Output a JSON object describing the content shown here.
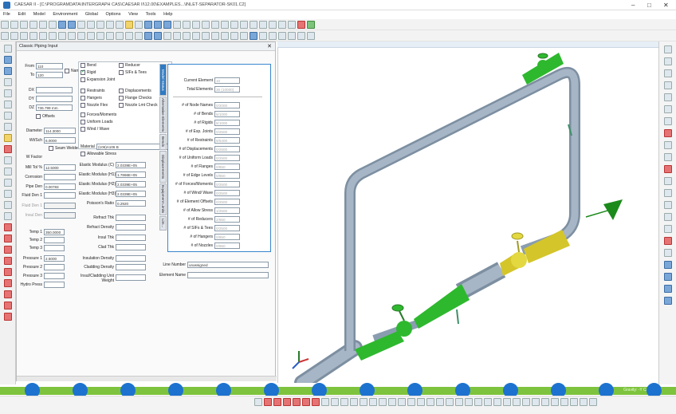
{
  "title": "CAESAR II - [C:\\PROGRAMDATA\\INTERGRAPH CAS\\CAESAR II\\12.00\\EXAMPLES...\\INLET-SEPARATOR-SK01.C2]",
  "window_controls": {
    "minimize": "–",
    "maximize": "□",
    "close": "✕"
  },
  "menu": [
    "File",
    "Edit",
    "Model",
    "Environment",
    "Global",
    "Options",
    "View",
    "Tools",
    "Help"
  ],
  "panel": {
    "title": "Classic Piping Input",
    "from_label": "From",
    "from_value": "110",
    "to_label": "To",
    "to_value": "120",
    "name_label": "Name",
    "dx_label": "DX",
    "dy_label": "DY",
    "dz_label": "DZ",
    "dz_value": "736.799 mm",
    "offsets_label": "Offsets",
    "diameter_label": "Diameter",
    "diameter_value": "114.3000",
    "wt_label": "Wt/Sch",
    "wt_value": "6.0000",
    "seam_label": "Seam Welded",
    "wifactor_label": "W Factor",
    "milltol_label": "Mill Tol %",
    "milltol_value": "12.5000",
    "corrosion_label": "Corrosion",
    "pipeden_label": "Pipe Den",
    "pipeden_value": "0.00783",
    "fluidden_label": "Fluid Den 1",
    "fluiddensg_label": "Fluid Den 1",
    "insul_label": "Insul Den",
    "temps": [
      {
        "label": "Temp 1",
        "value": "350.0000"
      },
      {
        "label": "Temp 2",
        "value": ""
      },
      {
        "label": "Temp 3",
        "value": ""
      }
    ],
    "pressures": [
      {
        "label": "Pressure 1",
        "value": "2.5000"
      },
      {
        "label": "Pressure 2",
        "value": ""
      },
      {
        "label": "Pressure 3",
        "value": ""
      }
    ],
    "hydro_label": "Hydro Press",
    "checks_col1": [
      {
        "label": "Bend",
        "on": false
      },
      {
        "label": "Rigid",
        "on": true
      },
      {
        "label": "Expansion Joint",
        "on": false
      }
    ],
    "checks_col2": [
      {
        "label": "Reducer",
        "on": false
      },
      {
        "label": "SIFs & Tees",
        "on": false
      }
    ],
    "checks_col3": [
      {
        "label": "Restraints",
        "on": false
      },
      {
        "label": "Hangers",
        "on": false
      },
      {
        "label": "Nozzle Flex",
        "on": false
      }
    ],
    "checks_col4": [
      {
        "label": "Displacements",
        "on": false
      },
      {
        "label": "Flange Checks",
        "on": false
      },
      {
        "label": "Nozzle Lmt Check",
        "on": false
      }
    ],
    "checks_col5": [
      {
        "label": "Forces/Moments",
        "on": false
      },
      {
        "label": "Uniform Loads",
        "on": false
      },
      {
        "label": "Wind / Wave",
        "on": false
      }
    ],
    "material_label": "Material",
    "material_value": "(106)A106 B",
    "allowable_label": "Allowable Stress",
    "elastic": [
      {
        "label": "Elastic Modulus (C)",
        "value": "2.0339E+05"
      },
      {
        "label": "Elastic Modulus (H1)",
        "value": "1.7866E+05"
      },
      {
        "label": "Elastic Modulus (H2)",
        "value": "2.0339E+05"
      },
      {
        "label": "Elastic Modulus (H3)",
        "value": "2.0339E+05"
      }
    ],
    "poisson_label": "Poisson's Ratio",
    "poisson_value": "0.2920",
    "refract_th_label": "Refract Thk",
    "refract_den_label": "Refract Density",
    "insul_th_label": "Insul Thk",
    "clad_th_label": "Clad Thk",
    "insul_den_label": "Insulation Density",
    "clad_den_label": "Cladding Density",
    "insul_clad_label": "Insul/Cladding Unit Weight",
    "line_label": "Line Number",
    "line_value": "unassigned",
    "element_label": "Element Name"
  },
  "sidetabs": [
    {
      "label": "Model Status",
      "active": true
    },
    {
      "label": "Alternative Elements",
      "active": false
    },
    {
      "label": "Bends",
      "active": false
    },
    {
      "label": "Displacements",
      "active": false
    },
    {
      "label": "Equipment Limits",
      "active": false
    },
    {
      "label": "Lim...",
      "active": false
    }
  ],
  "status": {
    "current_label": "Current Element",
    "current_value": "10",
    "total_label": "Total Elements",
    "total_value": "36 (10000)",
    "rows": [
      {
        "label": "# of Node Names",
        "value": "0/2000"
      },
      {
        "label": "# of Bends",
        "value": "6/1000"
      },
      {
        "label": "# of Rigids",
        "value": "8/1000"
      },
      {
        "label": "# of Exp. Joints",
        "value": "0/2500"
      },
      {
        "label": "# of Restraints",
        "value": "9/5400"
      },
      {
        "label": "# of Displacements",
        "value": "0/2500"
      },
      {
        "label": "# of Uniform Loads",
        "value": "0/2500"
      },
      {
        "label": "# of Flanges",
        "value": "0/850"
      },
      {
        "label": "# of Edge Levels",
        "value": "0/850"
      },
      {
        "label": "# of Forces/Moments",
        "value": "0/2500"
      },
      {
        "label": "# of Wind/ Wave",
        "value": "0/2500"
      },
      {
        "label": "# of Element Offsets",
        "value": "0/2500"
      },
      {
        "label": "# of Allow Stress",
        "value": "1/2500"
      },
      {
        "label": "# of Reducers",
        "value": "2/850"
      },
      {
        "label": "# of SIFs & Tees",
        "value": "0/2500"
      },
      {
        "label": "# of Hangers",
        "value": "0/850"
      },
      {
        "label": "# of Nozzles",
        "value": "0/850"
      }
    ]
  },
  "green_status": "Gravity: -Y    CAP    NUM",
  "colors": {
    "pipe": "#a7b6c6",
    "valve": "#2eb82e",
    "reducer_yellow": "#d4c52a",
    "accent_blue": "#1d72cf",
    "status_green": "#7ec33d"
  }
}
